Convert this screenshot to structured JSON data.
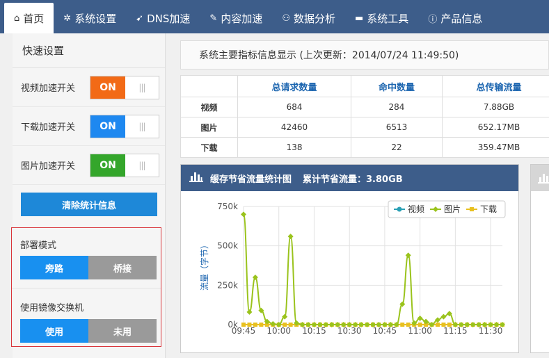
{
  "nav": {
    "items": [
      {
        "icon": "home-icon",
        "glyph": "⌂",
        "label": "首页",
        "active": true
      },
      {
        "icon": "gears-icon",
        "glyph": "✲",
        "label": "系统设置"
      },
      {
        "icon": "paper-plane-icon",
        "glyph": "➹",
        "label": "DNS加速"
      },
      {
        "icon": "edit-icon",
        "glyph": "✎",
        "label": "内容加速"
      },
      {
        "icon": "user-chart-icon",
        "glyph": "⚇",
        "label": "数据分析"
      },
      {
        "icon": "briefcase-icon",
        "glyph": "▬",
        "label": "系统工具"
      },
      {
        "icon": "info-icon",
        "glyph": "ⓘ",
        "label": "产品信息"
      }
    ]
  },
  "sidebar": {
    "title": "快速设置",
    "switches": [
      {
        "label": "视频加速开关",
        "state": "ON",
        "color": "#f26a16"
      },
      {
        "label": "下载加速开关",
        "state": "ON",
        "color": "#1e88f0"
      },
      {
        "label": "图片加速开关",
        "state": "ON",
        "color": "#34a62b"
      }
    ],
    "switch_off_glyph": "|||",
    "clear_button": "清除统计信息",
    "deploy_mode": {
      "title": "部署模式",
      "options": [
        "旁路",
        "桥接"
      ],
      "selected": 0
    },
    "mirror_switch": {
      "title": "使用镜像交换机",
      "options": [
        "使用",
        "未用"
      ],
      "selected": 0
    }
  },
  "info_bar": "系统主要指标信息显示 (上次更新：2014/07/24 11:49:50)",
  "stats_table": {
    "headers": [
      "",
      "总请求数量",
      "命中数量",
      "总传输流量"
    ],
    "rows": [
      [
        "视频",
        "684",
        "284",
        "7.88GB"
      ],
      [
        "图片",
        "42460",
        "6513",
        "652.17MB"
      ],
      [
        "下载",
        "138",
        "22",
        "359.47MB"
      ]
    ]
  },
  "chart_panel": {
    "title": "缓存节省流量统计图",
    "total": "累计节省流量：3.80GB"
  },
  "chart_data": {
    "type": "line",
    "ylabel": "流量（字节）",
    "ylim": [
      0,
      750000
    ],
    "yticks": [
      "0k",
      "250k",
      "500k",
      "750k"
    ],
    "xtick_labels": [
      "09:45",
      "10:00",
      "10:15",
      "10:30",
      "10:45",
      "11:00",
      "11:15",
      "11:30"
    ],
    "legend": [
      "视频",
      "图片",
      "下载"
    ],
    "legend_position": "top-right",
    "colors": {
      "视频": "#2aa0b5",
      "图片": "#9ac31c",
      "下载": "#e8c020"
    },
    "grid": true,
    "x": [
      "09:45",
      "09:47",
      "09:50",
      "09:52",
      "09:55",
      "09:57",
      "10:00",
      "10:02",
      "10:05",
      "10:07",
      "10:10",
      "10:12",
      "10:15",
      "10:17",
      "10:20",
      "10:22",
      "10:25",
      "10:27",
      "10:30",
      "10:32",
      "10:35",
      "10:37",
      "10:40",
      "10:42",
      "10:45",
      "10:47",
      "10:50",
      "10:52",
      "10:55",
      "10:57",
      "11:00",
      "11:02",
      "11:05",
      "11:07",
      "11:10",
      "11:12",
      "11:15",
      "11:17",
      "11:20",
      "11:22",
      "11:25",
      "11:27",
      "11:30",
      "11:32",
      "11:35"
    ],
    "series": [
      {
        "name": "视频",
        "values": [
          0,
          0,
          0,
          0,
          0,
          0,
          0,
          0,
          0,
          0,
          0,
          0,
          0,
          0,
          0,
          0,
          0,
          0,
          0,
          0,
          0,
          0,
          0,
          0,
          0,
          0,
          0,
          0,
          0,
          0,
          0,
          0,
          0,
          0,
          0,
          0,
          0,
          0,
          0,
          0,
          0,
          0,
          0,
          0,
          0
        ]
      },
      {
        "name": "图片",
        "values": [
          700000,
          80000,
          300000,
          90000,
          20000,
          5000,
          0,
          50000,
          560000,
          10000,
          0,
          0,
          0,
          0,
          0,
          0,
          0,
          0,
          0,
          0,
          0,
          0,
          0,
          0,
          0,
          0,
          0,
          130000,
          440000,
          10000,
          40000,
          20000,
          0,
          30000,
          50000,
          70000,
          0,
          0,
          0,
          0,
          0,
          0,
          0,
          0,
          0
        ]
      },
      {
        "name": "下载",
        "values": [
          0,
          0,
          0,
          0,
          0,
          0,
          0,
          0,
          0,
          0,
          0,
          0,
          0,
          0,
          0,
          0,
          0,
          0,
          0,
          0,
          0,
          0,
          0,
          0,
          0,
          0,
          0,
          0,
          0,
          0,
          0,
          0,
          0,
          0,
          0,
          0,
          0,
          0,
          0,
          0,
          0,
          0,
          0,
          0,
          0
        ]
      }
    ]
  }
}
